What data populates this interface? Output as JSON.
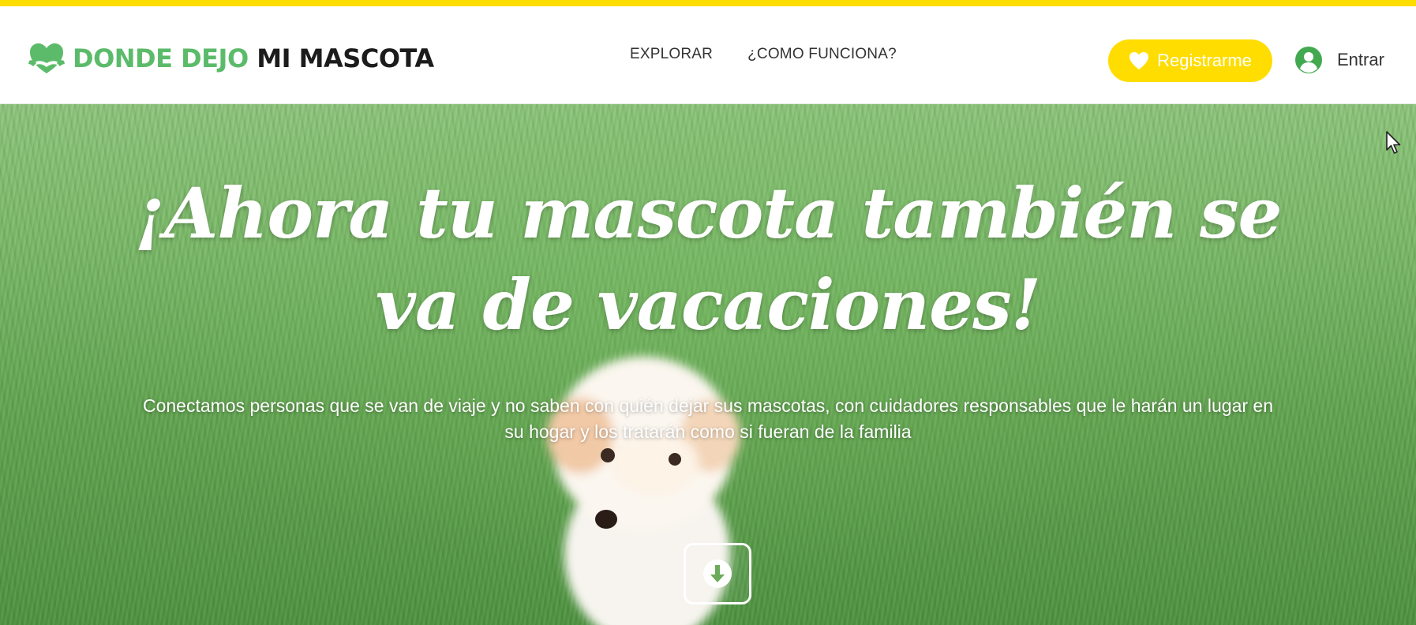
{
  "header": {
    "logo": {
      "text_primary": "DONDE DEJO",
      "text_secondary": "MI MASCOTA",
      "icon": "heart-hands-icon"
    },
    "nav": [
      {
        "label": "EXPLORAR"
      },
      {
        "label": "¿COMO FUNCIONA?"
      }
    ],
    "register_button": {
      "label": "Registrarme",
      "icon": "heart-icon"
    },
    "login": {
      "label": "Entrar",
      "icon": "user-icon"
    }
  },
  "hero": {
    "title": "¡Ahora tu mascota también se va de vacaciones!",
    "subtitle": "Conectamos personas que se van de viaje y no saben con quién dejar sus mascotas, con cuidadores responsables que le harán un lugar en su hogar y los tratarán como si fueran de la familia",
    "scroll_button_icon": "arrow-down-icon"
  },
  "colors": {
    "accent_yellow": "#ffdd00",
    "brand_green": "#5cbb6a",
    "text_dark": "#1c1c1c"
  }
}
